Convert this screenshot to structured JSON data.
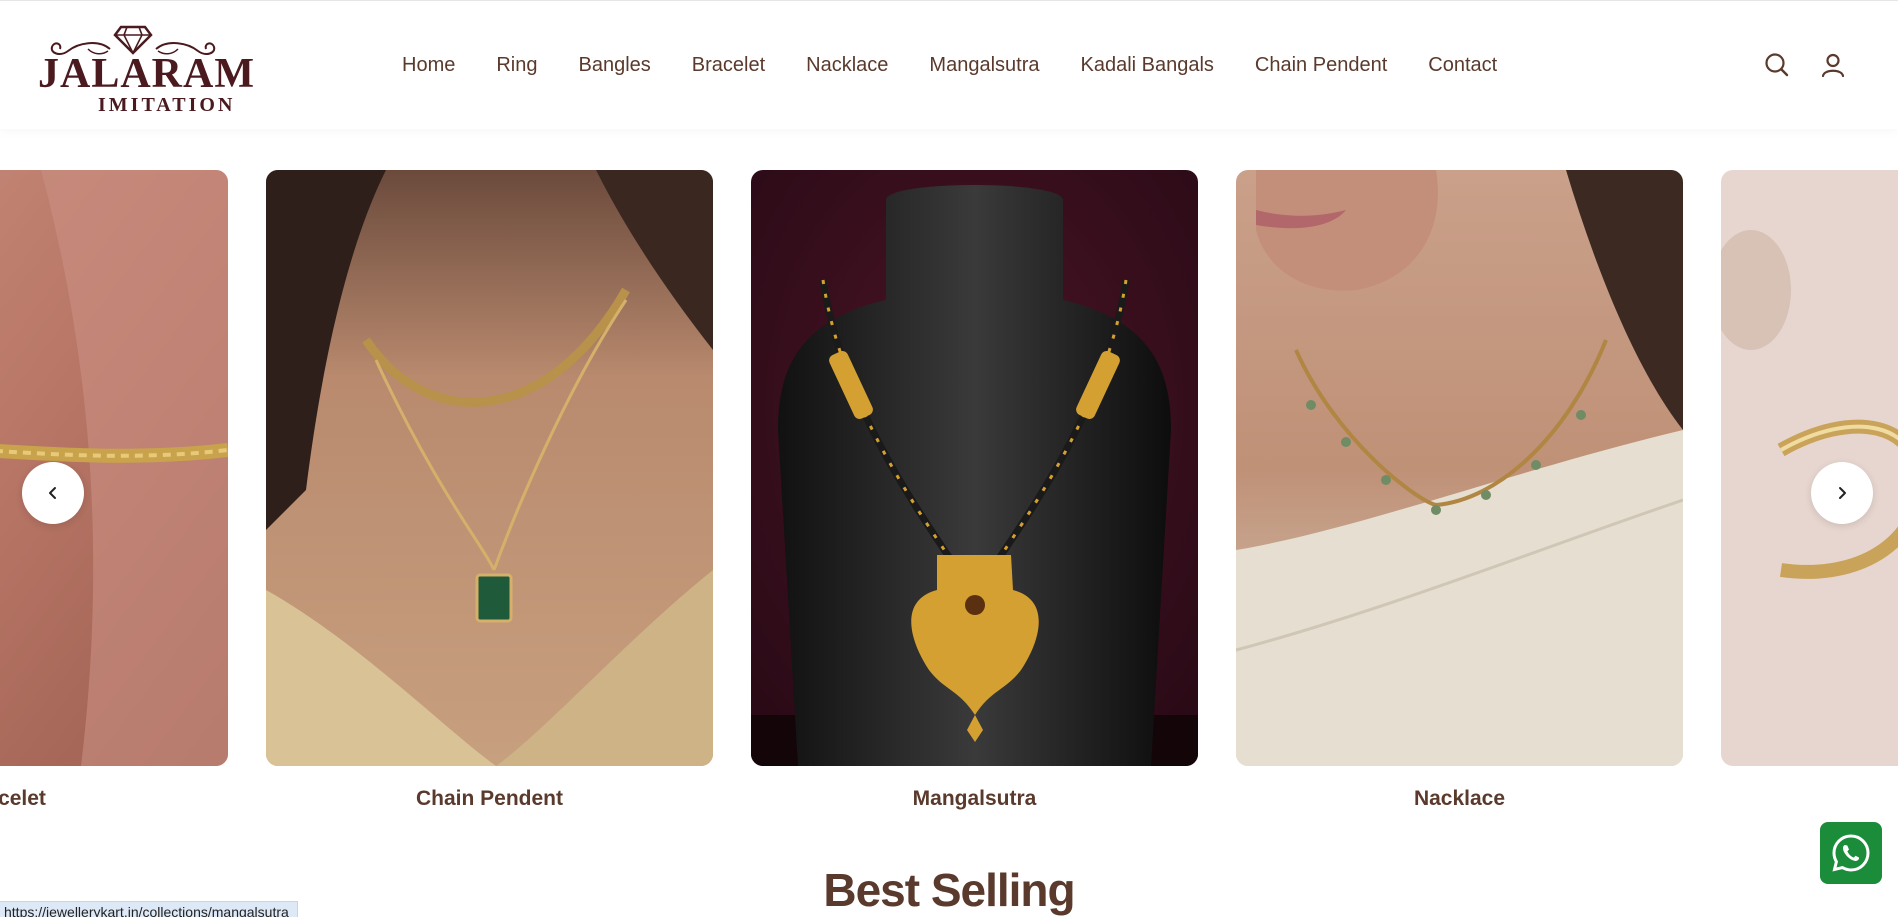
{
  "brand": {
    "name": "JALARAM",
    "tagline": "IMITATION"
  },
  "nav": {
    "items": [
      "Home",
      "Ring",
      "Bangles",
      "Bracelet",
      "Nacklace",
      "Mangalsutra",
      "Kadali Bangals",
      "Chain Pendent",
      "Contact"
    ]
  },
  "header_icons": [
    "search-icon",
    "account-icon"
  ],
  "carousel": {
    "cards": [
      {
        "label": "Bracelet"
      },
      {
        "label": "Chain Pendent"
      },
      {
        "label": "Mangalsutra"
      },
      {
        "label": "Nacklace"
      },
      {
        "label": ""
      }
    ],
    "prev_icon": "chevron-left-icon",
    "next_icon": "chevron-right-icon"
  },
  "best_selling": {
    "title": "Best Selling"
  },
  "status_bar": {
    "url": "https://jewellerykart.in/collections/mangalsutra"
  },
  "colors": {
    "brand": "#4a1a1f",
    "text": "#5a3a2c",
    "whatsapp": "#1a8c3a"
  }
}
